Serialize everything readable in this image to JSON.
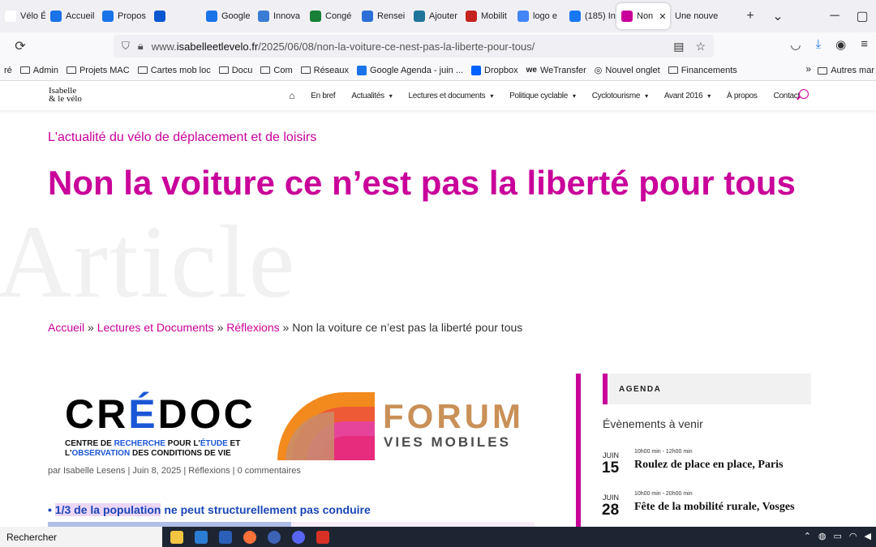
{
  "browser": {
    "tabs": [
      {
        "label": "Vélo Ég",
        "color": "#ffffff"
      },
      {
        "label": "Accueil",
        "color": "#1a73e8"
      },
      {
        "label": "Propos",
        "color": "#1a73e8"
      },
      {
        "label": "",
        "color": "#0b57d0"
      },
      {
        "label": "Google",
        "color": "#1a73e8"
      },
      {
        "label": "Innova",
        "color": "#3a7bd5"
      },
      {
        "label": "Congé",
        "color": "#188038"
      },
      {
        "label": "Rensei",
        "color": "#2d6fd6"
      },
      {
        "label": "Ajouter",
        "color": "#21759b"
      },
      {
        "label": "Mobilit",
        "color": "#c5221f"
      },
      {
        "label": "logo e",
        "color": "#4285f4"
      },
      {
        "label": "(185) In",
        "color": "#1877f2"
      },
      {
        "label": "Non",
        "color": "#c9009a",
        "active": true
      },
      {
        "label": "Une nouve",
        "color": ""
      }
    ],
    "url_prefix": "www.",
    "url_host": "isabelleetlevelo.fr",
    "url_path": "/2025/06/08/non-la-voiture-ce-nest-pas-la-liberte-pour-tous/",
    "bookmarks": [
      {
        "label": "Admin",
        "kind": "folder"
      },
      {
        "label": "Projets MAC",
        "kind": "folder"
      },
      {
        "label": "Cartes mob loc",
        "kind": "folder"
      },
      {
        "label": "Docu",
        "kind": "folder"
      },
      {
        "label": "Com",
        "kind": "folder"
      },
      {
        "label": "Réseaux",
        "kind": "folder"
      },
      {
        "label": "Google Agenda - juin ...",
        "kind": "calendar"
      },
      {
        "label": "Dropbox",
        "kind": "dropbox"
      },
      {
        "label": "WeTransfer",
        "kind": "we"
      },
      {
        "label": "Nouvel onglet",
        "kind": "globe"
      },
      {
        "label": "Financements",
        "kind": "folder"
      }
    ],
    "bookmarks_first": "ré",
    "bookmarks_other": "Autres mar"
  },
  "site": {
    "logo_line1": "Isabelle",
    "logo_line2": "& le vélo",
    "menu": [
      {
        "label": "En bref",
        "chevron": false
      },
      {
        "label": "Actualités",
        "chevron": true
      },
      {
        "label": "Lectures et documents",
        "chevron": true
      },
      {
        "label": "Politique cyclable",
        "chevron": true
      },
      {
        "label": "Cyclotourisme",
        "chevron": true
      },
      {
        "label": "Avant 2016",
        "chevron": true
      },
      {
        "label": "À propos",
        "chevron": false
      },
      {
        "label": "Contact",
        "chevron": false
      }
    ],
    "accent": "#c9009a"
  },
  "hero": {
    "watermark": "Article",
    "tagline": "L'actualité du vélo de déplacement et de loisirs",
    "title": "Non la voiture ce n’est pas la liberté pour tous"
  },
  "breadcrumb": {
    "home": "Accueil",
    "section": "Lectures et Documents",
    "category": "Réflexions",
    "current": "Non la voiture ce n’est pas la liberté pour tous",
    "sep": "»"
  },
  "article": {
    "credoc_a": "CR",
    "credoc_b": "É",
    "credoc_c": "DOC",
    "credoc_sub1a": "CENTRE DE ",
    "credoc_sub1b": "RECHERCHE",
    "credoc_sub1c": " POUR L'",
    "credoc_sub1d": "ÉTUDE",
    "credoc_sub1e": " ET",
    "credoc_sub2a": "L'",
    "credoc_sub2b": "OBSERVATION",
    "credoc_sub2c": " DES CONDITIONS DE VIE",
    "forum_word": "FORUM",
    "forum_sub": "VIES MOBILES",
    "meta": "par Isabelle Lesens | Juin 8, 2025 | Réflexions | 0 commentaires",
    "bullet_hl": "1/3 de la population",
    "bullet_rest": " ne peut structurellement pas conduire"
  },
  "sidebar": {
    "agenda": "AGENDA",
    "events_heading": "Évènements à venir",
    "events": [
      {
        "month": "JUIN",
        "day": "15",
        "time": "10h00 min - 12h00 min",
        "name": "Roulez de place en place, Paris"
      },
      {
        "month": "JUIN",
        "day": "28",
        "time": "10h00 min - 20h00 min",
        "name": "Fête de la mobilité rurale, Vosges"
      }
    ]
  },
  "taskbar": {
    "search": "Rechercher"
  }
}
